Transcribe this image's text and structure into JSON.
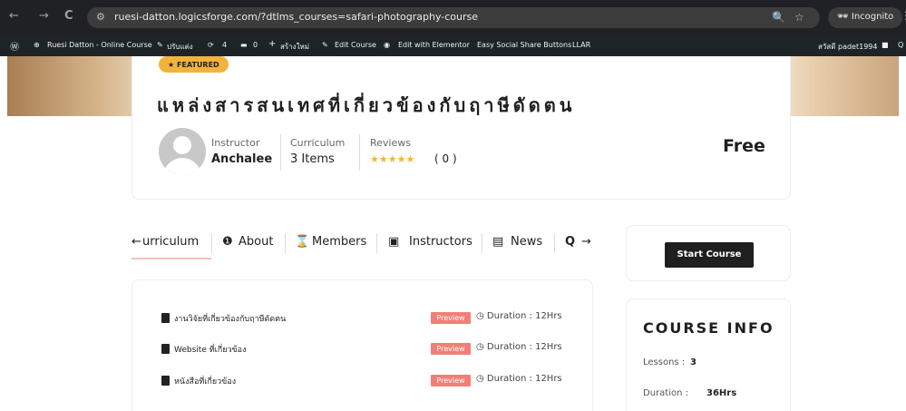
{
  "browser": {
    "back": "←",
    "forward": "→",
    "reload": "C",
    "site_settings_icon": "⚙",
    "url": "ruesi-datton.logicsforge.com/?dtlms_courses=safari-photography-course",
    "search_glyph": "🔍",
    "star_glyph": "☆",
    "incognito_label": "Incognito",
    "incognito_glyph": "🕶",
    "menu_glyph": "⋮"
  },
  "wp_admin_bar": {
    "wp_logo": "Ⓦ",
    "site_glyph": "⊕",
    "site_name": "Ruesi Datton - Online Course",
    "customize_glyph": "✎",
    "customize": "ปรับแต่ง",
    "updates_glyph": "⟳",
    "updates_count": "4",
    "comments_glyph": "▬",
    "comments_count": "0",
    "new_glyph": "+",
    "new_label": "สร้างใหม่",
    "edit_glyph": "✎",
    "edit_course": "Edit Course",
    "elementor_glyph": "◉",
    "edit_elementor": "Edit with Elementor",
    "social_buttons": "Easy Social Share Buttons",
    "llar": "LLAR",
    "greeting": "สวัสดี padet1994",
    "user_glyph": "■",
    "search_glyph": "Q"
  },
  "course": {
    "featured_badge": "★ FEATURED",
    "title": "แหล่งสารสนเทศที่เกี่ยวข้องกับฤาษีดัดตน",
    "instructor_label": "Instructor",
    "instructor_name": "Anchalee",
    "curriculum_label": "Curriculum",
    "curriculum_value": "3 Items",
    "reviews_label": "Reviews",
    "rating_stars": "★★★★★",
    "rating": 4.5,
    "reviews_count": "( 0 )",
    "price": "Free"
  },
  "tabs": {
    "prev_arrow": "←",
    "curriculum": "urriculum",
    "about_icon": "❶",
    "about": "About",
    "members_icon": "⌛",
    "members": "Members",
    "instructors_icon": "▣",
    "instructors": "Instructors",
    "news_icon": "▤",
    "news": "News",
    "search_icon": "Q",
    "next_arrow": "→"
  },
  "start_button": "Start Course",
  "lessons": [
    {
      "title": "งานวิจัยที่เกี่ยวข้องกับฤาษีดัดตน",
      "badge": "Preview",
      "duration": "Duration : 12Hrs"
    },
    {
      "title": "Website ที่เกี่ยวข้อง",
      "badge": "Preview",
      "duration": "Duration : 12Hrs"
    },
    {
      "title": "หนังสือที่เกี่ยวข้อง",
      "badge": "Preview",
      "duration": "Duration : 12Hrs"
    }
  ],
  "clock_glyph": "◷",
  "course_info": {
    "title": "COURSE INFO",
    "lessons_label": "Lessons :",
    "lessons_value": "3",
    "duration_label": "Duration :",
    "duration_value": "36Hrs"
  }
}
